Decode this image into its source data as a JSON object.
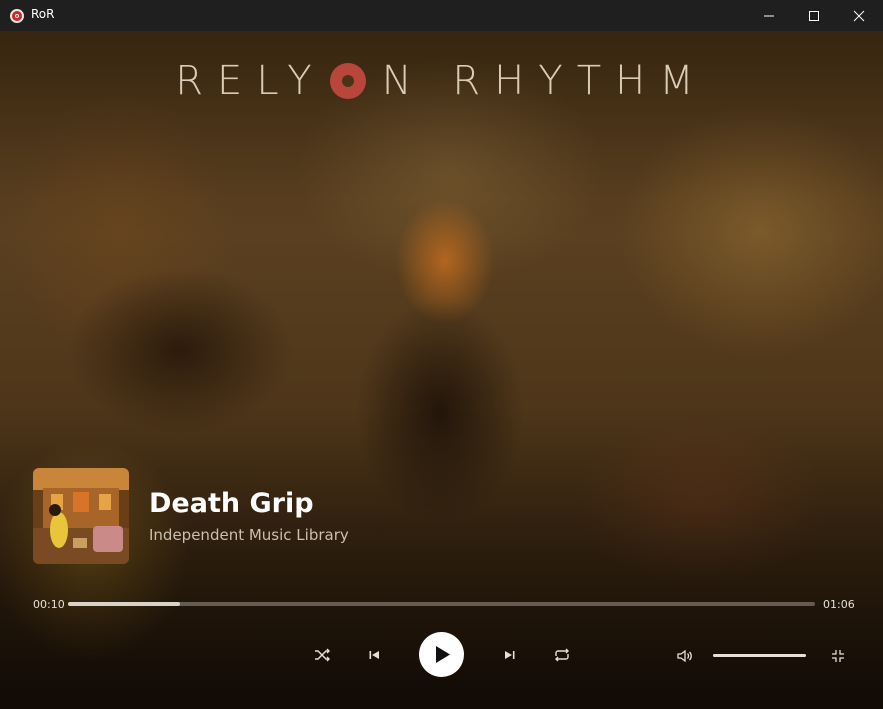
{
  "window": {
    "title": "RoR",
    "icon": "record-icon",
    "controls": [
      "minimize-icon",
      "maximize-icon",
      "close-icon"
    ]
  },
  "logo": {
    "text_before": "RELY",
    "text_after": "N RHYTHM",
    "o_color": "#b8463c"
  },
  "now_playing": {
    "title": "Death Grip",
    "artist": "Independent Music Library",
    "album_art": "album-art-image"
  },
  "progress": {
    "elapsed": "00:10",
    "total": "01:06",
    "fraction": 0.15
  },
  "controls": {
    "shuffle": "shuffle-icon",
    "previous": "skip-previous-icon",
    "play": "play-icon",
    "next": "skip-next-icon",
    "repeat": "repeat-icon",
    "volume_icon": "volume-icon",
    "volume_level": 1.0,
    "collapse": "collapse-icon"
  },
  "colors": {
    "titlebar": "#1f1f1f",
    "accent": "#b8463c",
    "text": "#ffffff",
    "subtext": "#cbbfae"
  }
}
